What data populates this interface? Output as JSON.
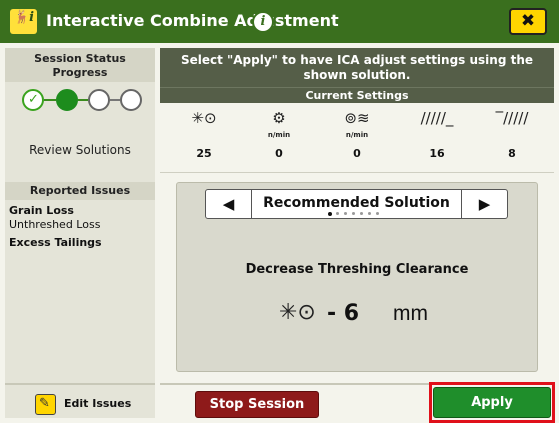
{
  "window": {
    "logo_text": "🦌i",
    "title": "Interactive Combine Adjustment",
    "info_glyph": "i",
    "close_glyph": "✖"
  },
  "sidebar": {
    "session_status": "Session Status",
    "progress": "Progress",
    "current_step_label": "Review Solutions",
    "reported_issues_title": "Reported Issues",
    "issues": [
      {
        "label": "Grain Loss",
        "bold": true
      },
      {
        "label": "Unthreshed Loss",
        "bold": false
      },
      {
        "label": "Excess Tailings",
        "bold": true
      }
    ],
    "edit_issues_label": "Edit Issues"
  },
  "banner": {
    "line1": "Select \"Apply\" to have ICA adjust settings using the",
    "line2": "shown solution."
  },
  "current_settings": {
    "title": "Current Settings",
    "items": [
      {
        "icon": "concave-clearance-icon",
        "glyph": "✳⊙",
        "unit": "",
        "value": "25"
      },
      {
        "icon": "rotor-speed-icon",
        "glyph": "⚙",
        "unit": "n/min",
        "value": "0"
      },
      {
        "icon": "fan-speed-icon",
        "glyph": "⊚≋",
        "unit": "n/min",
        "value": "0"
      },
      {
        "icon": "upper-sieve-icon",
        "glyph": "/////_",
        "unit": "",
        "value": "16"
      },
      {
        "icon": "lower-sieve-icon",
        "glyph": "‾/////",
        "unit": "",
        "value": "8"
      }
    ]
  },
  "solution": {
    "title": "Recommended Solution",
    "prev_glyph": "◀",
    "next_glyph": "▶",
    "page_count": 7,
    "current_page": 1,
    "action": "Decrease Threshing Clearance",
    "adjust_icon_glyph": "✳⊙",
    "adjust_value": "- 6",
    "adjust_unit": "mm"
  },
  "buttons": {
    "stop_session": "Stop Session",
    "apply": "Apply"
  },
  "colors": {
    "header_green": "#3a6f1e",
    "apply_green": "#1f8e2b",
    "stop_red": "#8e1a1a",
    "highlight_red": "#e0101a"
  }
}
